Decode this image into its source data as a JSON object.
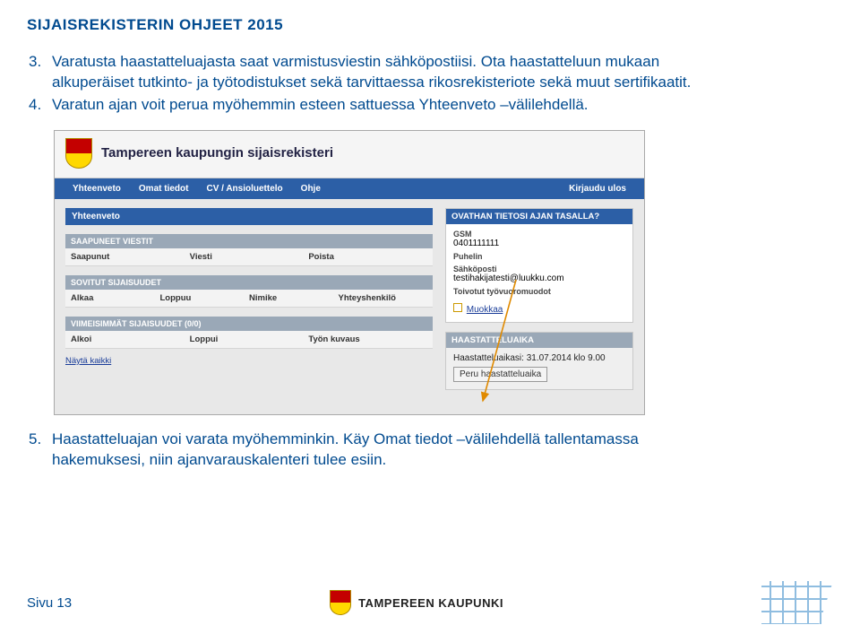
{
  "doc": {
    "title": "SIJAISREKISTERIN OHJEET 2015",
    "page_label": "Sivu 13",
    "brand": "TAMPEREEN KAUPUNKI"
  },
  "bullets": {
    "n3": "3.",
    "t3": "Varatusta haastatteluajasta saat varmistusviestin sähköpostiisi. Ota haastatteluun mukaan alkuperäiset tutkinto- ja työtodistukset sekä tarvittaessa rikosrekisteriote sekä muut sertifikaatit.",
    "n4": "4.",
    "t4": "Varatun ajan voit perua myöhemmin esteen sattuessa Yhteenveto –välilehdellä.",
    "n5": "5.",
    "t5": "Haastatteluajan voi varata myöhemminkin. Käy Omat tiedot –välilehdellä tallentamassa hakemuksesi, niin ajanvarauskalenteri tulee esiin."
  },
  "screenshot": {
    "app_title": "Tampereen kaupungin sijaisrekisteri",
    "nav": {
      "items": [
        "Yhteenveto",
        "Omat tiedot",
        "CV / Ansioluettelo",
        "Ohje"
      ],
      "logout": "Kirjaudu ulos"
    },
    "left": {
      "panel_title": "Yhteenveto",
      "section1": {
        "title": "SAAPUNEET VIESTIT",
        "cols": [
          "Saapunut",
          "Viesti",
          "Poista"
        ]
      },
      "section2": {
        "title": "SOVITUT SIJAISUUDET",
        "cols": [
          "Alkaa",
          "Loppuu",
          "Nimike",
          "Yhteyshenkilö"
        ]
      },
      "section3": {
        "title": "VIIMEISIMMÄT SIJAISUUDET (0/0)",
        "cols": [
          "Alkoi",
          "Loppui",
          "Työn kuvaus"
        ]
      },
      "show_all": "Näytä kaikki"
    },
    "right": {
      "info": {
        "title": "OVATHAN TIETOSI AJAN TASALLA?",
        "gsm_label": "GSM",
        "gsm_value": "0401111111",
        "phone_label": "Puhelin",
        "email_label": "Sähköposti",
        "email_value": "testihakijatesti@luukku.com",
        "shifts_label": "Toivotut työvuoromuodot",
        "edit": "Muokkaa"
      },
      "interview": {
        "title": "HAASTATTELUAIKA",
        "detail": "Haastatteluaikasi: 31.07.2014 klo 9.00",
        "button": "Peru haastatteluaika"
      }
    }
  }
}
